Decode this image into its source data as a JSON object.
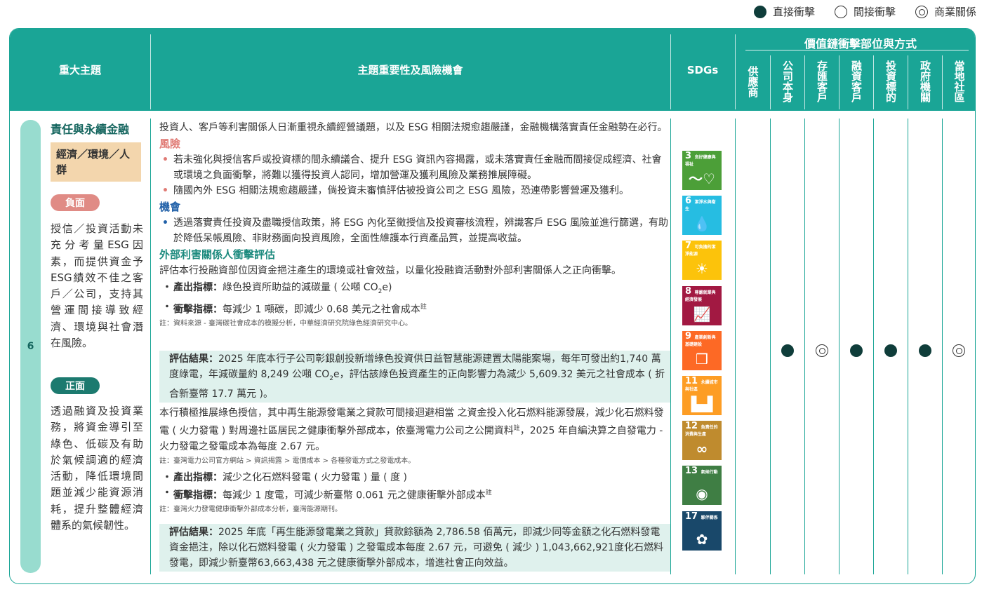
{
  "legend": {
    "direct": "直接衝擊",
    "indirect": "間接衝擊",
    "business": "商業關係"
  },
  "header": {
    "topic": "重大主題",
    "importance": "主題重要性及風險機會",
    "sdgs": "SDGs",
    "value_chain_title": "價值鏈衝擊部位與方式",
    "value_chain_cols": [
      "供應商",
      "公司本身",
      "存匯客戶",
      "融資客戶",
      "投資標的",
      "政府機關",
      "當地社區"
    ]
  },
  "row": {
    "number": "6",
    "topic_title": "責任與永續金融",
    "topic_tag": "經濟／環境／人群",
    "negative_label": "負面",
    "negative_text": "授信／投資活動未充分考量ESG因素，而提供資金予ESG績效不佳之客戶／公司，支持其營運間接導致經濟、環境與社會潛在風險。",
    "positive_label": "正面",
    "positive_text": "透過融資及投資業務，將資金導引至綠色、低碳及有助於氣候調適的經濟活動，降低環境問題並減少能資源消耗，提升整體經濟體系的氣候韌性。"
  },
  "middle": {
    "intro": "投資人、客戶等利害關係人日漸重視永續經營議題，以及 ESG 相關法規愈趨嚴謹，金融機構落實責任金融勢在必行。",
    "risk_heading": "風險",
    "risk_items": [
      "若未強化與授信客戶或投資標的間永續議合、提升 ESG 資訊內容揭露，或未落實責任金融而間接促成經濟、社會或環境之負面衝擊，將難以獲得投資人認同，增加營運及獲利風險及業務推展障礙。",
      "隨國內外 ESG 相關法規愈趨嚴謹，倘投資未審慎評估被投資公司之 ESG 風險，恐連帶影響營運及獲利。"
    ],
    "opp_heading": "機會",
    "opp_items": [
      "透過落實責任投資及盡職授信政策，將 ESG 內化至徵授信及投資審核流程，辨識客戶 ESG 風險並進行篩選，有助於降低呆帳風險、非財務面向投資風險，全面性維護本行資產品質，並提高收益。"
    ],
    "ext_heading": "外部利害關係人衝擊評估",
    "ext_intro": "評估本行投融資部位因資金挹注產生的環境或社會效益，以量化投融資活動對外部利害關係人之正向衝擊。",
    "output_label": "產出指標：",
    "output_text_1": "綠色投資所助益的減碳量 ( 公噸 CO",
    "output_sub": "2",
    "output_text_2": "e)",
    "impact_label": "衝擊指標：",
    "impact_text": "每減少 1 噸碳，即減少 0.68 美元之社會成本",
    "note_sup": "註",
    "note1": "註：資料來源 - 臺灣碳社會成本的模擬分析，中華經濟研究院綠色經濟研究中心。",
    "eval1_label": "評估結果：",
    "eval1_text_a": "2025 年底本行子公司彰銀創投新增綠色投資供日益智慧能源建置太陽能案場，每年可發出約1,740 萬度綠電，年減碳量約 8,249 公噸 CO",
    "eval1_sub": "2",
    "eval1_text_b": "e，評估該綠色投資產生的正向影響力為減少 5,609.32 美元之社會成本 ( 折合新臺幣 17.7 萬元 )。",
    "para2": "本行積極推展綠色授信，其中再生能源發電業之貸款可間接迴避相當 之資金投入化石燃料能源發展，減少化石燃料發電 ( 火力發電 ) 對周邊社區居民之健康衝擊外部成本，依臺灣電力公司之公開資料",
    "para2_tail": "，2025 年自編決算之自發電力 - 火力發電之發電成本為每度 2.67 元。",
    "note2": "註：臺灣電力公司官方網站 > 資訊揭露 > 電價成本 > 各種發電方式之發電成本。",
    "output2_label": "產出指標：",
    "output2_text": "減少之化石燃料發電 ( 火力發電 ) 量 ( 度 )",
    "impact2_label": "衝擊指標：",
    "impact2_text": "每減少 1 度電，可減少新臺幣 0.061 元之健康衝擊外部成本",
    "note3": "註：臺灣火力發電健康衝擊外部成本分析，臺灣能源期刊。",
    "eval2_label": "評估結果：",
    "eval2_text": "2025 年底「再生能源發電業之貸款」貸款餘額為 2,786.58 佰萬元，即減少同等金額之化石燃料發電資金挹注，除以化石燃料發電 ( 火力發電 ) 之發電成本每度 2.67 元，可避免 ( 減少 ) 1,043,662,921度化石燃料發電，即減少新臺幣63,663,438 元之健康衝擊外部成本，增進社會正向效益。"
  },
  "sdgs": [
    {
      "num": "3",
      "label": "良好健康與福祉",
      "color": "#4c9f38",
      "icon": "heartbeat-icon",
      "glyph": "〜♡"
    },
    {
      "num": "6",
      "label": "潔淨水與衛生",
      "color": "#26bde2",
      "icon": "water-drop-icon",
      "glyph": "💧"
    },
    {
      "num": "7",
      "label": "可負擔的潔淨能源",
      "color": "#fcc30b",
      "icon": "sun-icon",
      "glyph": "☀"
    },
    {
      "num": "8",
      "label": "尊嚴就業與經濟發展",
      "color": "#a21942",
      "icon": "growth-chart-icon",
      "glyph": "📈"
    },
    {
      "num": "9",
      "label": "產業創新與基礎建設",
      "color": "#fd6925",
      "icon": "cubes-icon",
      "glyph": "❒"
    },
    {
      "num": "11",
      "label": "永續城市與社區",
      "color": "#fd9d24",
      "icon": "city-icon",
      "glyph": "▙▟"
    },
    {
      "num": "12",
      "label": "負責任的消費與生產",
      "color": "#bf8b2e",
      "icon": "infinity-icon",
      "glyph": "∞"
    },
    {
      "num": "13",
      "label": "氣候行動",
      "color": "#3f7e44",
      "icon": "earth-eye-icon",
      "glyph": "◉"
    },
    {
      "num": "17",
      "label": "夥伴關係",
      "color": "#19486a",
      "icon": "flower-rings-icon",
      "glyph": "✿"
    }
  ],
  "value_chain_marks": [
    "none",
    "direct",
    "business",
    "direct",
    "direct",
    "direct",
    "business"
  ],
  "colors": {
    "header_teal": "#1aa596",
    "direct_dot": "#0f3d3a",
    "negative_pill": "#e08b85",
    "positive_pill": "#1c7a6f",
    "tag_bg": "#f3d6ad",
    "eval_bg": "#dff1ed"
  }
}
